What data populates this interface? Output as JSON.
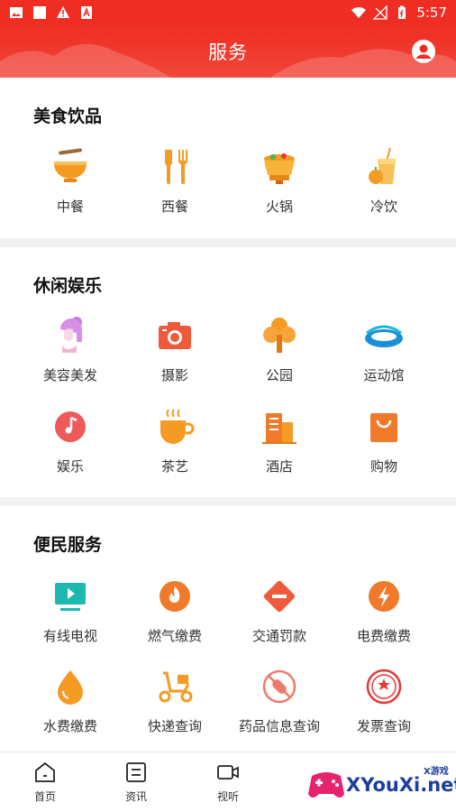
{
  "status_bar": {
    "time": "5:57"
  },
  "header": {
    "title": "服务"
  },
  "sections": [
    {
      "title": "美食饮品",
      "items": [
        {
          "label": "中餐",
          "icon": "bowl-noodles-icon"
        },
        {
          "label": "西餐",
          "icon": "knife-fork-icon"
        },
        {
          "label": "火锅",
          "icon": "hotpot-icon"
        },
        {
          "label": "冷饮",
          "icon": "cold-drink-icon"
        }
      ]
    },
    {
      "title": "休闲娱乐",
      "items": [
        {
          "label": "美容美发",
          "icon": "beauty-hair-icon"
        },
        {
          "label": "摄影",
          "icon": "camera-icon"
        },
        {
          "label": "公园",
          "icon": "tree-icon"
        },
        {
          "label": "运动馆",
          "icon": "stadium-icon"
        },
        {
          "label": "娱乐",
          "icon": "music-note-icon"
        },
        {
          "label": "茶艺",
          "icon": "tea-cup-icon"
        },
        {
          "label": "酒店",
          "icon": "hotel-building-icon"
        },
        {
          "label": "购物",
          "icon": "shopping-bag-icon"
        }
      ]
    },
    {
      "title": "便民服务",
      "items": [
        {
          "label": "有线电视",
          "icon": "tv-icon"
        },
        {
          "label": "燃气缴费",
          "icon": "flame-icon"
        },
        {
          "label": "交通罚款",
          "icon": "traffic-sign-icon"
        },
        {
          "label": "电费缴费",
          "icon": "lightning-icon"
        },
        {
          "label": "水费缴费",
          "icon": "water-drop-icon"
        },
        {
          "label": "快递查询",
          "icon": "delivery-scooter-icon"
        },
        {
          "label": "药品信息查询",
          "icon": "medicine-capsule-icon"
        },
        {
          "label": "发票查询",
          "icon": "invoice-seal-icon"
        }
      ]
    }
  ],
  "tabbar": [
    {
      "label": "首页",
      "icon": "home-icon"
    },
    {
      "label": "资讯",
      "icon": "news-icon"
    },
    {
      "label": "视听",
      "icon": "video-icon"
    }
  ],
  "watermark": {
    "text": "XYouXi.net",
    "sub": "X游戏"
  },
  "colors": {
    "brand_red": "#ef2d22",
    "icon_orange": "#f59a23",
    "icon_red": "#ee5a3a",
    "teal": "#1db8b0"
  }
}
